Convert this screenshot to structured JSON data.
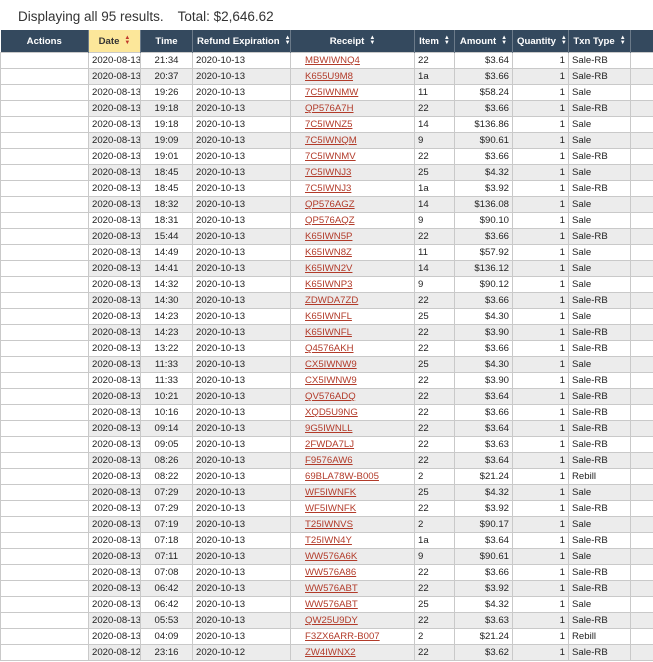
{
  "summary": {
    "displaying": "Displaying all 95 results.",
    "total": "Total: $2,646.62"
  },
  "columns": [
    {
      "label": "Actions",
      "sortable": false,
      "sorted": false
    },
    {
      "label": "Date",
      "sortable": true,
      "sorted": true
    },
    {
      "label": "Time",
      "sortable": false,
      "sorted": false
    },
    {
      "label": "Refund Expiration",
      "sortable": true,
      "sorted": false
    },
    {
      "label": "Receipt",
      "sortable": true,
      "sorted": false
    },
    {
      "label": "Item",
      "sortable": true,
      "sorted": false
    },
    {
      "label": "Amount",
      "sortable": true,
      "sorted": false
    },
    {
      "label": "Quantity",
      "sortable": true,
      "sorted": false
    },
    {
      "label": "Txn Type",
      "sortable": true,
      "sorted": false
    },
    {
      "label": "",
      "sortable": false,
      "sorted": false
    }
  ],
  "rows": [
    [
      "2020-08-13",
      "21:34",
      "2020-10-13",
      "MBWIWNQ4",
      "22",
      "$3.64",
      "1",
      "Sale-RB"
    ],
    [
      "2020-08-13",
      "20:37",
      "2020-10-13",
      "K655U9M8",
      "1a",
      "$3.66",
      "1",
      "Sale-RB"
    ],
    [
      "2020-08-13",
      "19:26",
      "2020-10-13",
      "7C5IWNMW",
      "11",
      "$58.24",
      "1",
      "Sale"
    ],
    [
      "2020-08-13",
      "19:18",
      "2020-10-13",
      "QP576A7H",
      "22",
      "$3.66",
      "1",
      "Sale-RB"
    ],
    [
      "2020-08-13",
      "19:18",
      "2020-10-13",
      "7C5IWNZ5",
      "14",
      "$136.86",
      "1",
      "Sale"
    ],
    [
      "2020-08-13",
      "19:09",
      "2020-10-13",
      "7C5IWNQM",
      "9",
      "$90.61",
      "1",
      "Sale"
    ],
    [
      "2020-08-13",
      "19:01",
      "2020-10-13",
      "7C5IWNMV",
      "22",
      "$3.66",
      "1",
      "Sale-RB"
    ],
    [
      "2020-08-13",
      "18:45",
      "2020-10-13",
      "7C5IWNJ3",
      "25",
      "$4.32",
      "1",
      "Sale"
    ],
    [
      "2020-08-13",
      "18:45",
      "2020-10-13",
      "7C5IWNJ3",
      "1a",
      "$3.92",
      "1",
      "Sale-RB"
    ],
    [
      "2020-08-13",
      "18:32",
      "2020-10-13",
      "QP576AGZ",
      "14",
      "$136.08",
      "1",
      "Sale"
    ],
    [
      "2020-08-13",
      "18:31",
      "2020-10-13",
      "QP576AQZ",
      "9",
      "$90.10",
      "1",
      "Sale"
    ],
    [
      "2020-08-13",
      "15:44",
      "2020-10-13",
      "K65IWN5P",
      "22",
      "$3.66",
      "1",
      "Sale-RB"
    ],
    [
      "2020-08-13",
      "14:49",
      "2020-10-13",
      "K65IWN8Z",
      "11",
      "$57.92",
      "1",
      "Sale"
    ],
    [
      "2020-08-13",
      "14:41",
      "2020-10-13",
      "K65IWN2V",
      "14",
      "$136.12",
      "1",
      "Sale"
    ],
    [
      "2020-08-13",
      "14:32",
      "2020-10-13",
      "K65IWNP3",
      "9",
      "$90.12",
      "1",
      "Sale"
    ],
    [
      "2020-08-13",
      "14:30",
      "2020-10-13",
      "ZDWDA7ZD",
      "22",
      "$3.66",
      "1",
      "Sale-RB"
    ],
    [
      "2020-08-13",
      "14:23",
      "2020-10-13",
      "K65IWNFL",
      "25",
      "$4.30",
      "1",
      "Sale"
    ],
    [
      "2020-08-13",
      "14:23",
      "2020-10-13",
      "K65IWNFL",
      "22",
      "$3.90",
      "1",
      "Sale-RB"
    ],
    [
      "2020-08-13",
      "13:22",
      "2020-10-13",
      "Q4576AKH",
      "22",
      "$3.66",
      "1",
      "Sale-RB"
    ],
    [
      "2020-08-13",
      "11:33",
      "2020-10-13",
      "CX5IWNW9",
      "25",
      "$4.30",
      "1",
      "Sale"
    ],
    [
      "2020-08-13",
      "11:33",
      "2020-10-13",
      "CX5IWNW9",
      "22",
      "$3.90",
      "1",
      "Sale-RB"
    ],
    [
      "2020-08-13",
      "10:21",
      "2020-10-13",
      "QV576ADQ",
      "22",
      "$3.64",
      "1",
      "Sale-RB"
    ],
    [
      "2020-08-13",
      "10:16",
      "2020-10-13",
      "XQD5U9NG",
      "22",
      "$3.66",
      "1",
      "Sale-RB"
    ],
    [
      "2020-08-13",
      "09:14",
      "2020-10-13",
      "9G5IWNLL",
      "22",
      "$3.64",
      "1",
      "Sale-RB"
    ],
    [
      "2020-08-13",
      "09:05",
      "2020-10-13",
      "2FWDA7LJ",
      "22",
      "$3.63",
      "1",
      "Sale-RB"
    ],
    [
      "2020-08-13",
      "08:26",
      "2020-10-13",
      "F9576AW6",
      "22",
      "$3.64",
      "1",
      "Sale-RB"
    ],
    [
      "2020-08-13",
      "08:22",
      "2020-10-13",
      "69BLA78W-B005",
      "2",
      "$21.24",
      "1",
      "Rebill"
    ],
    [
      "2020-08-13",
      "07:29",
      "2020-10-13",
      "WF5IWNFK",
      "25",
      "$4.32",
      "1",
      "Sale"
    ],
    [
      "2020-08-13",
      "07:29",
      "2020-10-13",
      "WF5IWNFK",
      "22",
      "$3.92",
      "1",
      "Sale-RB"
    ],
    [
      "2020-08-13",
      "07:19",
      "2020-10-13",
      "T25IWNVS",
      "2",
      "$90.17",
      "1",
      "Sale"
    ],
    [
      "2020-08-13",
      "07:18",
      "2020-10-13",
      "T25IWN4Y",
      "1a",
      "$3.64",
      "1",
      "Sale-RB"
    ],
    [
      "2020-08-13",
      "07:11",
      "2020-10-13",
      "WW576A6K",
      "9",
      "$90.61",
      "1",
      "Sale"
    ],
    [
      "2020-08-13",
      "07:08",
      "2020-10-13",
      "WW576A86",
      "22",
      "$3.66",
      "1",
      "Sale-RB"
    ],
    [
      "2020-08-13",
      "06:42",
      "2020-10-13",
      "WW576ABT",
      "22",
      "$3.92",
      "1",
      "Sale-RB"
    ],
    [
      "2020-08-13",
      "06:42",
      "2020-10-13",
      "WW576ABT",
      "25",
      "$4.32",
      "1",
      "Sale"
    ],
    [
      "2020-08-13",
      "05:53",
      "2020-10-13",
      "QW25U9DY",
      "22",
      "$3.63",
      "1",
      "Sale-RB"
    ],
    [
      "2020-08-13",
      "04:09",
      "2020-10-13",
      "F3ZX6ARR-B007",
      "2",
      "$21.24",
      "1",
      "Rebill"
    ],
    [
      "2020-08-12",
      "23:16",
      "2020-10-12",
      "ZW4IWNX2",
      "22",
      "$3.62",
      "1",
      "Sale-RB"
    ]
  ]
}
